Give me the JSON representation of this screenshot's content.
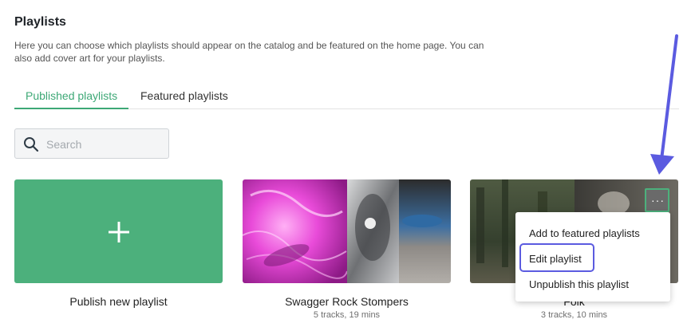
{
  "header": {
    "title": "Playlists",
    "description": "Here you can choose which playlists should appear on the catalog and be featured on the home page. You can also add cover art for your playlists."
  },
  "tabs": [
    {
      "label": "Published playlists",
      "active": true
    },
    {
      "label": "Featured playlists",
      "active": false
    }
  ],
  "search": {
    "placeholder": "Search",
    "value": ""
  },
  "cards": [
    {
      "name": "Publish new playlist",
      "meta": ""
    },
    {
      "name": "Swagger Rock Stompers",
      "meta": "5 tracks, 19 mins"
    },
    {
      "name": "Folk",
      "meta": "3 tracks, 10 mins"
    }
  ],
  "more_button": {
    "label": "···"
  },
  "menu": {
    "items": [
      "Add to featured playlists",
      "Edit playlist",
      "Unpublish this playlist"
    ]
  },
  "colors": {
    "accent": "#4cb07c",
    "accent_text": "#3da876",
    "annotation": "#5b5be0"
  },
  "icons": [
    "search-icon",
    "plus-icon",
    "more-icon",
    "annotation-arrow"
  ]
}
